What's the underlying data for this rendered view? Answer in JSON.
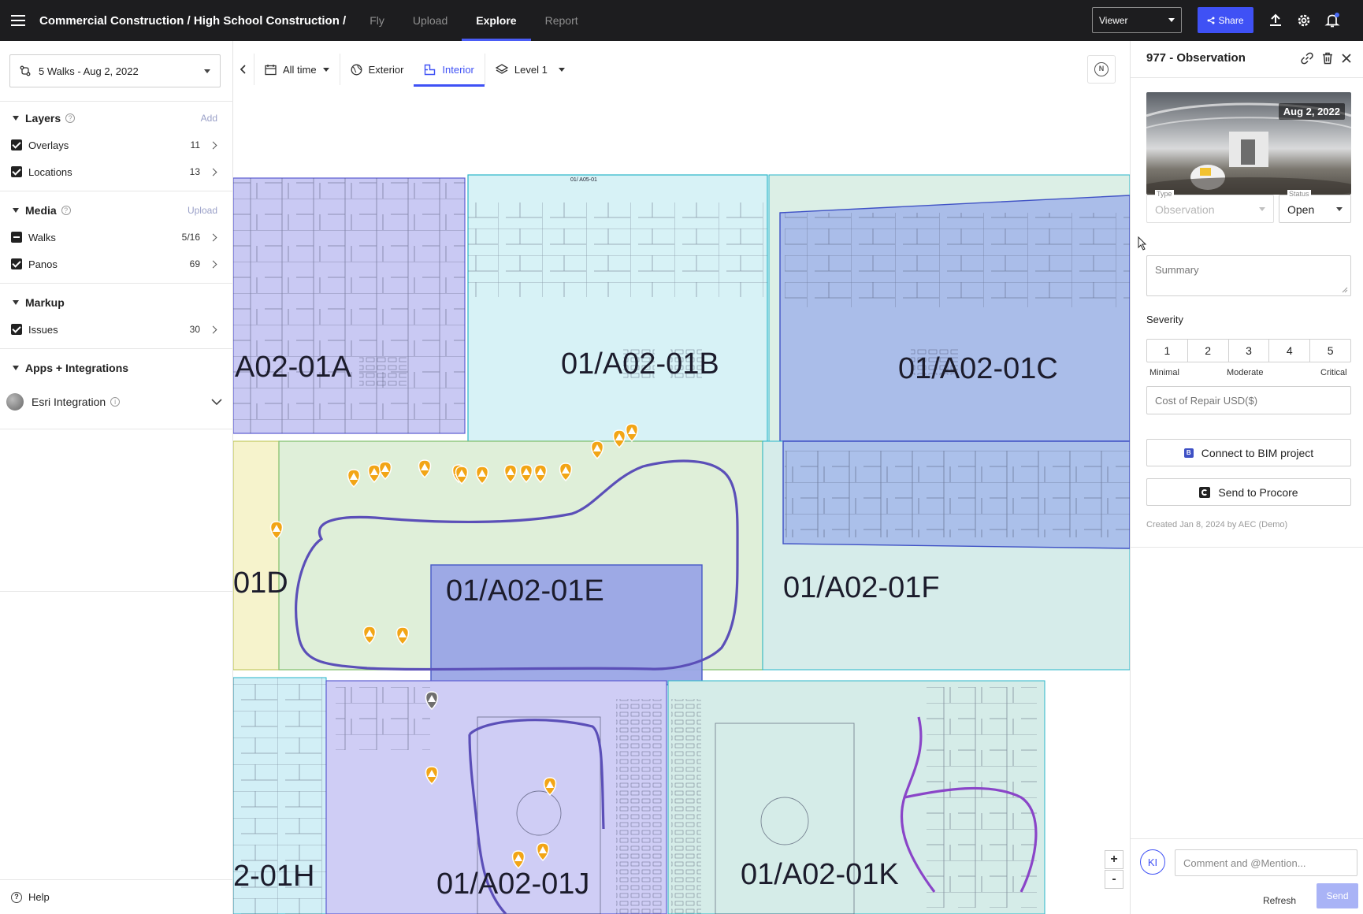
{
  "topbar": {
    "breadcrumb": "Commercial Construction / High School Construction /",
    "tabs": [
      {
        "label": "Fly",
        "active": false
      },
      {
        "label": "Upload",
        "active": false
      },
      {
        "label": "Explore",
        "active": true
      },
      {
        "label": "Report",
        "active": false
      }
    ],
    "viewer_select": "Viewer",
    "share_label": "Share"
  },
  "sidebar": {
    "walks_select": "5 Walks - Aug 2, 2022",
    "layers": {
      "title": "Layers",
      "action": "Add",
      "items": [
        {
          "label": "Overlays",
          "count": "11",
          "state": "checked"
        },
        {
          "label": "Locations",
          "count": "13",
          "state": "checked"
        }
      ]
    },
    "media": {
      "title": "Media",
      "action": "Upload",
      "items": [
        {
          "label": "Walks",
          "count": "5/16",
          "state": "partial"
        },
        {
          "label": "Panos",
          "count": "69",
          "state": "checked"
        }
      ]
    },
    "markup": {
      "title": "Markup",
      "items": [
        {
          "label": "Issues",
          "count": "30",
          "state": "checked"
        }
      ]
    },
    "apps": {
      "title": "Apps + Integrations",
      "esri_label": "Esri Integration"
    },
    "help_label": "Help"
  },
  "map": {
    "toolbar": {
      "time_label": "All time",
      "exterior_label": "Exterior",
      "interior_label": "Interior",
      "level_label": "Level 1"
    },
    "compass_label": "N",
    "zone_labels": {
      "a": "A02-01A",
      "b": "01/A02-01B",
      "c": "01/A02-01C",
      "d": "01D",
      "e": "01/A02-01E",
      "f": "01/A02-01F",
      "h": "2-01H",
      "j": "01/A02-01J",
      "k": "01/A02-01K",
      "small_top": "01/ A05-01"
    },
    "zoom_in": "+",
    "zoom_out": "-",
    "colors": {
      "walk_path": "#5b4fb8",
      "issue_marker": "#f2a516",
      "zone_purple": "#c8c8f2",
      "zone_cyan": "#d5f1f6",
      "zone_blue": "#a9bde8",
      "zone_green": "#dcefd8",
      "zone_yellow": "#f6f3cc"
    }
  },
  "details": {
    "title": "977 - Observation",
    "pano_date": "Aug 2, 2022",
    "type_label": "Type",
    "type_value": "Observation",
    "status_label": "Status",
    "status_value": "Open",
    "summary_placeholder": "Summary",
    "severity_title": "Severity",
    "severity_levels": [
      "1",
      "2",
      "3",
      "4",
      "5"
    ],
    "severity_captions": {
      "low": "Minimal",
      "mid": "Moderate",
      "high": "Critical"
    },
    "cost_placeholder": "Cost of Repair USD($)",
    "bim_label": "Connect to BIM project",
    "procore_label": "Send to Procore",
    "created_text": "Created Jan 8, 2024 by AEC (Demo)",
    "avatar_initials": "KI",
    "comment_placeholder": "Comment and @Mention...",
    "refresh_label": "Refresh",
    "send_label": "Send"
  }
}
